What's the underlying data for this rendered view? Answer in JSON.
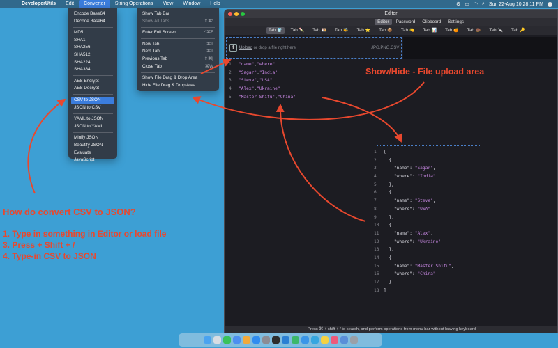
{
  "menubar": {
    "app_name": "DeveloperUtils",
    "items": [
      "Edit",
      "Converter",
      "String Operations",
      "View",
      "Window",
      "Help"
    ],
    "clock": "Sun 22-Aug  10:28:11 PM"
  },
  "converter_menu": {
    "groups": [
      [
        "Encode Base64",
        "Decode Base64"
      ],
      [
        "MD5",
        "SHA1",
        "SHA256",
        "SHA512",
        "SHA224",
        "SHA384"
      ],
      [
        "AES Encrypt",
        "AES Decrypt"
      ],
      [
        "CSV to JSON",
        "JSON to CSV"
      ],
      [
        "YAML to JSON",
        "JSON to YAML"
      ],
      [
        "Minify JSON",
        "Beautify JSON",
        "Evaluate JavaScript"
      ]
    ],
    "selected": "CSV to JSON"
  },
  "view_menu": {
    "items": [
      {
        "label": "Show Tab Bar",
        "shortcut": ""
      },
      {
        "label": "Show All Tabs",
        "shortcut": "⇧⌘\\",
        "disabled": true
      },
      {
        "sep": true
      },
      {
        "label": "Enter Full Screen",
        "shortcut": "^⌘F"
      },
      {
        "sep": true
      },
      {
        "label": "New Tab",
        "shortcut": "⌘T"
      },
      {
        "label": "Next Tab",
        "shortcut": "⌘T"
      },
      {
        "label": "Previous Tab",
        "shortcut": "⇧⌘["
      },
      {
        "label": "Close Tab",
        "shortcut": "⌘W"
      },
      {
        "sep": true
      },
      {
        "label": "Show File Drag & Drop Area",
        "shortcut": ""
      },
      {
        "label": "Hide File Drag & Drop Area",
        "shortcut": ""
      }
    ]
  },
  "editor": {
    "window_title": "Editor",
    "segments": [
      "Editor",
      "Password",
      "Clipboard",
      "Settings"
    ],
    "active_segment": "Editor",
    "tabs": [
      {
        "label": "Tab",
        "icon": "👕"
      },
      {
        "label": "Tab",
        "icon": "🍡"
      },
      {
        "label": "Tab",
        "icon": "🍱"
      },
      {
        "label": "Tab",
        "icon": "🐝"
      },
      {
        "label": "Tab",
        "icon": "⭐"
      },
      {
        "label": "Tab",
        "icon": "📦"
      },
      {
        "label": "Tab",
        "icon": "🍋"
      },
      {
        "label": "Tab",
        "icon": "📊"
      },
      {
        "label": "Tab",
        "icon": "🍊"
      },
      {
        "label": "Tab",
        "icon": "🍩"
      },
      {
        "label": "Tab",
        "icon": "🔪"
      },
      {
        "label": "Tab",
        "icon": "🔑"
      }
    ],
    "upload": {
      "link": "Upload",
      "text": " or drop a file right here",
      "formats": "JPG,PNG,CSV"
    },
    "input_lines": [
      "\"name\",\"where\"",
      "\"Sagar\",\"India\"",
      "\"Steve\",\"USA\"",
      "\"Alex\",\"Ukraine\"",
      "\"Master Shifu\",\"China\""
    ],
    "output_lines": [
      "[",
      "  {",
      "    \"name\": \"Sagar\",",
      "    \"where\": \"India\"",
      "  },",
      "  {",
      "    \"name\": \"Steve\",",
      "    \"where\": \"USA\"",
      "  },",
      "  {",
      "    \"name\": \"Alex\",",
      "    \"where\": \"Ukraine\"",
      "  },",
      "  {",
      "    \"name\": \"Master Shifu\",",
      "    \"where\": \"China\"",
      "  }",
      "]"
    ],
    "status": "Press ⌘ + shift + / to search, and perform operations from menu bar without leaving keyboard"
  },
  "annotations": {
    "title": "How do convert CSV to JSON?",
    "steps": [
      "1. Type in something in Editor or load file",
      "3. Press + Shift + /",
      "4. Type-in CSV to JSON"
    ],
    "upload_callout": "Show/Hide - File upload area"
  },
  "colors": {
    "desktop": "#3d9fd4",
    "annotation": "#e8482e",
    "selection": "#3b7ddd",
    "string": "#c586e0"
  },
  "dock_icons": [
    "finder-icon",
    "launchpad-icon",
    "messages-icon",
    "mail-icon",
    "photos-icon",
    "appstore-icon",
    "settings-icon",
    "terminal-icon",
    "vscode-icon",
    "maps-icon",
    "safari-icon",
    "telegram-icon",
    "notes-icon",
    "music-icon",
    "files-icon",
    "trash-icon"
  ]
}
